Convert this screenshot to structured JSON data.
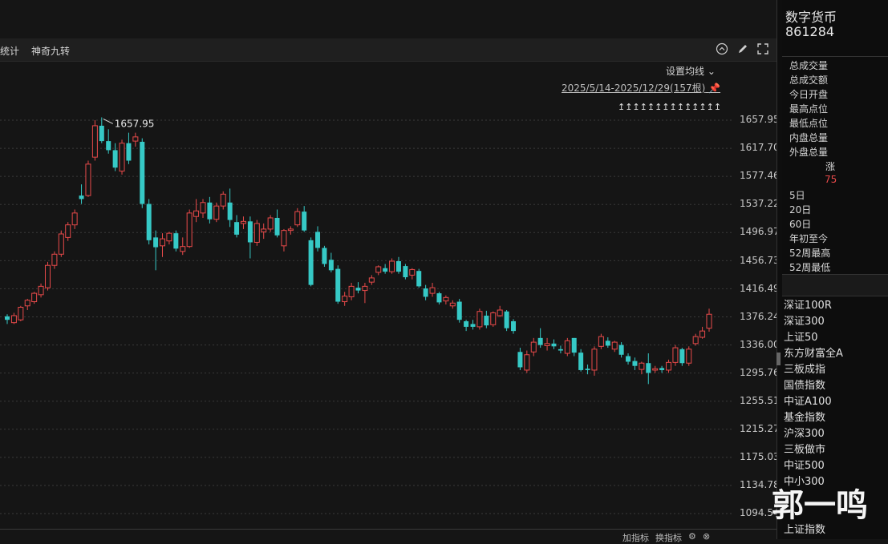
{
  "toolbar": {
    "stats_label": "统计",
    "tool_label": "神奇九转"
  },
  "chart_controls": {
    "set_ma_label": "设置均线 ⌄",
    "range_label": "2025/5/14-2025/12/29(157根)",
    "arrows": "↥↥↥↥↥↥↥↥↥↥↥↥↥↥",
    "bottom_add": "加指标",
    "bottom_change": "换指标"
  },
  "chart_data": {
    "type": "candlestick",
    "y_ticks": [
      "1657.95",
      "1617.70",
      "1577.46",
      "1537.22",
      "1496.97",
      "1456.73",
      "1416.49",
      "1376.24",
      "1336.00",
      "1295.76",
      "1255.51",
      "1215.27",
      "1175.03",
      "1134.78",
      "1094.54"
    ],
    "ylim": [
      1094.54,
      1657.95
    ],
    "high_marker": "1657.95",
    "up_color": "#e84a4a",
    "down_color": "#36c9c6",
    "candles": [
      {
        "o": 1377,
        "h": 1380,
        "l": 1366,
        "c": 1372
      },
      {
        "o": 1368,
        "h": 1382,
        "l": 1366,
        "c": 1378
      },
      {
        "o": 1372,
        "h": 1392,
        "l": 1370,
        "c": 1390
      },
      {
        "o": 1392,
        "h": 1402,
        "l": 1386,
        "c": 1400
      },
      {
        "o": 1398,
        "h": 1412,
        "l": 1395,
        "c": 1410
      },
      {
        "o": 1408,
        "h": 1424,
        "l": 1404,
        "c": 1420
      },
      {
        "o": 1418,
        "h": 1455,
        "l": 1414,
        "c": 1450
      },
      {
        "o": 1450,
        "h": 1470,
        "l": 1445,
        "c": 1466
      },
      {
        "o": 1466,
        "h": 1500,
        "l": 1462,
        "c": 1495
      },
      {
        "o": 1490,
        "h": 1512,
        "l": 1485,
        "c": 1508
      },
      {
        "o": 1508,
        "h": 1530,
        "l": 1502,
        "c": 1525
      },
      {
        "o": 1550,
        "h": 1566,
        "l": 1538,
        "c": 1545
      },
      {
        "o": 1550,
        "h": 1600,
        "l": 1548,
        "c": 1595
      },
      {
        "o": 1605,
        "h": 1658,
        "l": 1600,
        "c": 1650
      },
      {
        "o": 1650,
        "h": 1662,
        "l": 1625,
        "c": 1628
      },
      {
        "o": 1628,
        "h": 1645,
        "l": 1610,
        "c": 1615
      },
      {
        "o": 1615,
        "h": 1625,
        "l": 1585,
        "c": 1590
      },
      {
        "o": 1585,
        "h": 1630,
        "l": 1580,
        "c": 1625
      },
      {
        "o": 1625,
        "h": 1640,
        "l": 1595,
        "c": 1600
      },
      {
        "o": 1628,
        "h": 1640,
        "l": 1620,
        "c": 1634
      },
      {
        "o": 1627,
        "h": 1632,
        "l": 1532,
        "c": 1538
      },
      {
        "o": 1538,
        "h": 1545,
        "l": 1480,
        "c": 1486
      },
      {
        "o": 1490,
        "h": 1500,
        "l": 1443,
        "c": 1476
      },
      {
        "o": 1478,
        "h": 1496,
        "l": 1462,
        "c": 1488
      },
      {
        "o": 1485,
        "h": 1498,
        "l": 1480,
        "c": 1496
      },
      {
        "o": 1496,
        "h": 1500,
        "l": 1470,
        "c": 1474
      },
      {
        "o": 1470,
        "h": 1490,
        "l": 1465,
        "c": 1477
      },
      {
        "o": 1477,
        "h": 1530,
        "l": 1475,
        "c": 1525
      },
      {
        "o": 1520,
        "h": 1545,
        "l": 1512,
        "c": 1528
      },
      {
        "o": 1525,
        "h": 1545,
        "l": 1518,
        "c": 1540
      },
      {
        "o": 1540,
        "h": 1548,
        "l": 1510,
        "c": 1516
      },
      {
        "o": 1516,
        "h": 1540,
        "l": 1512,
        "c": 1535
      },
      {
        "o": 1535,
        "h": 1556,
        "l": 1530,
        "c": 1552
      },
      {
        "o": 1540,
        "h": 1560,
        "l": 1505,
        "c": 1515
      },
      {
        "o": 1512,
        "h": 1522,
        "l": 1490,
        "c": 1494
      },
      {
        "o": 1510,
        "h": 1520,
        "l": 1502,
        "c": 1513
      },
      {
        "o": 1513,
        "h": 1520,
        "l": 1460,
        "c": 1483
      },
      {
        "o": 1483,
        "h": 1515,
        "l": 1478,
        "c": 1510
      },
      {
        "o": 1498,
        "h": 1510,
        "l": 1488,
        "c": 1502
      },
      {
        "o": 1502,
        "h": 1522,
        "l": 1498,
        "c": 1518
      },
      {
        "o": 1518,
        "h": 1530,
        "l": 1490,
        "c": 1493
      },
      {
        "o": 1478,
        "h": 1502,
        "l": 1470,
        "c": 1500
      },
      {
        "o": 1500,
        "h": 1506,
        "l": 1494,
        "c": 1502
      },
      {
        "o": 1508,
        "h": 1532,
        "l": 1505,
        "c": 1527
      },
      {
        "o": 1527,
        "h": 1535,
        "l": 1498,
        "c": 1500
      },
      {
        "o": 1486,
        "h": 1490,
        "l": 1420,
        "c": 1422
      },
      {
        "o": 1498,
        "h": 1506,
        "l": 1470,
        "c": 1475
      },
      {
        "o": 1475,
        "h": 1478,
        "l": 1448,
        "c": 1452
      },
      {
        "o": 1458,
        "h": 1468,
        "l": 1440,
        "c": 1443
      },
      {
        "o": 1445,
        "h": 1450,
        "l": 1395,
        "c": 1398
      },
      {
        "o": 1398,
        "h": 1412,
        "l": 1392,
        "c": 1406
      },
      {
        "o": 1405,
        "h": 1425,
        "l": 1400,
        "c": 1420
      },
      {
        "o": 1418,
        "h": 1426,
        "l": 1410,
        "c": 1414
      },
      {
        "o": 1414,
        "h": 1425,
        "l": 1396,
        "c": 1420
      },
      {
        "o": 1426,
        "h": 1436,
        "l": 1422,
        "c": 1432
      },
      {
        "o": 1440,
        "h": 1450,
        "l": 1436,
        "c": 1448
      },
      {
        "o": 1446,
        "h": 1452,
        "l": 1438,
        "c": 1441
      },
      {
        "o": 1441,
        "h": 1460,
        "l": 1438,
        "c": 1456
      },
      {
        "o": 1456,
        "h": 1462,
        "l": 1438,
        "c": 1441
      },
      {
        "o": 1449,
        "h": 1452,
        "l": 1430,
        "c": 1433
      },
      {
        "o": 1436,
        "h": 1446,
        "l": 1430,
        "c": 1444
      },
      {
        "o": 1442,
        "h": 1445,
        "l": 1418,
        "c": 1420
      },
      {
        "o": 1417,
        "h": 1422,
        "l": 1400,
        "c": 1405
      },
      {
        "o": 1410,
        "h": 1425,
        "l": 1405,
        "c": 1418
      },
      {
        "o": 1410,
        "h": 1412,
        "l": 1394,
        "c": 1397
      },
      {
        "o": 1399,
        "h": 1407,
        "l": 1394,
        "c": 1404
      },
      {
        "o": 1392,
        "h": 1400,
        "l": 1388,
        "c": 1396
      },
      {
        "o": 1398,
        "h": 1402,
        "l": 1368,
        "c": 1372
      },
      {
        "o": 1370,
        "h": 1372,
        "l": 1356,
        "c": 1362
      },
      {
        "o": 1366,
        "h": 1372,
        "l": 1358,
        "c": 1362
      },
      {
        "o": 1362,
        "h": 1388,
        "l": 1358,
        "c": 1384
      },
      {
        "o": 1378,
        "h": 1385,
        "l": 1360,
        "c": 1364
      },
      {
        "o": 1365,
        "h": 1384,
        "l": 1362,
        "c": 1382
      },
      {
        "o": 1378,
        "h": 1392,
        "l": 1376,
        "c": 1386
      },
      {
        "o": 1384,
        "h": 1386,
        "l": 1356,
        "c": 1360
      },
      {
        "o": 1370,
        "h": 1373,
        "l": 1352,
        "c": 1356
      },
      {
        "o": 1326,
        "h": 1332,
        "l": 1300,
        "c": 1304
      },
      {
        "o": 1300,
        "h": 1328,
        "l": 1296,
        "c": 1322
      },
      {
        "o": 1326,
        "h": 1346,
        "l": 1320,
        "c": 1340
      },
      {
        "o": 1346,
        "h": 1360,
        "l": 1332,
        "c": 1336
      },
      {
        "o": 1335,
        "h": 1346,
        "l": 1328,
        "c": 1338
      },
      {
        "o": 1338,
        "h": 1344,
        "l": 1330,
        "c": 1334
      },
      {
        "o": 1330,
        "h": 1335,
        "l": 1324,
        "c": 1328
      },
      {
        "o": 1324,
        "h": 1346,
        "l": 1320,
        "c": 1342
      },
      {
        "o": 1346,
        "h": 1346,
        "l": 1320,
        "c": 1325
      },
      {
        "o": 1325,
        "h": 1330,
        "l": 1298,
        "c": 1300
      },
      {
        "o": 1302,
        "h": 1308,
        "l": 1294,
        "c": 1300
      },
      {
        "o": 1300,
        "h": 1334,
        "l": 1292,
        "c": 1330
      },
      {
        "o": 1334,
        "h": 1352,
        "l": 1330,
        "c": 1348
      },
      {
        "o": 1342,
        "h": 1347,
        "l": 1332,
        "c": 1335
      },
      {
        "o": 1330,
        "h": 1342,
        "l": 1326,
        "c": 1340
      },
      {
        "o": 1336,
        "h": 1340,
        "l": 1318,
        "c": 1322
      },
      {
        "o": 1320,
        "h": 1324,
        "l": 1308,
        "c": 1312
      },
      {
        "o": 1313,
        "h": 1318,
        "l": 1300,
        "c": 1306
      },
      {
        "o": 1301,
        "h": 1312,
        "l": 1294,
        "c": 1310
      },
      {
        "o": 1310,
        "h": 1324,
        "l": 1280,
        "c": 1296
      },
      {
        "o": 1300,
        "h": 1306,
        "l": 1296,
        "c": 1302
      },
      {
        "o": 1303,
        "h": 1306,
        "l": 1296,
        "c": 1300
      },
      {
        "o": 1300,
        "h": 1315,
        "l": 1296,
        "c": 1311
      },
      {
        "o": 1311,
        "h": 1336,
        "l": 1306,
        "c": 1332
      },
      {
        "o": 1330,
        "h": 1332,
        "l": 1306,
        "c": 1310
      },
      {
        "o": 1310,
        "h": 1334,
        "l": 1306,
        "c": 1330
      },
      {
        "o": 1338,
        "h": 1352,
        "l": 1335,
        "c": 1348
      },
      {
        "o": 1347,
        "h": 1362,
        "l": 1345,
        "c": 1356
      },
      {
        "o": 1360,
        "h": 1388,
        "l": 1355,
        "c": 1380
      }
    ]
  },
  "right_panel": {
    "name": "数字货币",
    "code": "861284",
    "fields": [
      "总成交量",
      "总成交额",
      "今日开盘",
      "最高点位",
      "最低点位",
      "内盘总量",
      "外盘总量"
    ],
    "rise_label": "涨",
    "rise_value": "75",
    "rise_color": "#e84a4a",
    "periods": [
      "5日",
      "20日",
      "60日",
      "年初至今",
      "52周最高",
      "52周最低"
    ],
    "index_list": [
      "深证100R",
      "深证300",
      "上证50",
      "东方财富全A",
      "三板成指",
      "国债指数",
      "中证A100",
      "基金指数",
      "沪深300",
      "三板做市",
      "中证500",
      "中小300",
      "",
      "",
      "上证指数"
    ]
  },
  "watermark": "郭一鸣"
}
